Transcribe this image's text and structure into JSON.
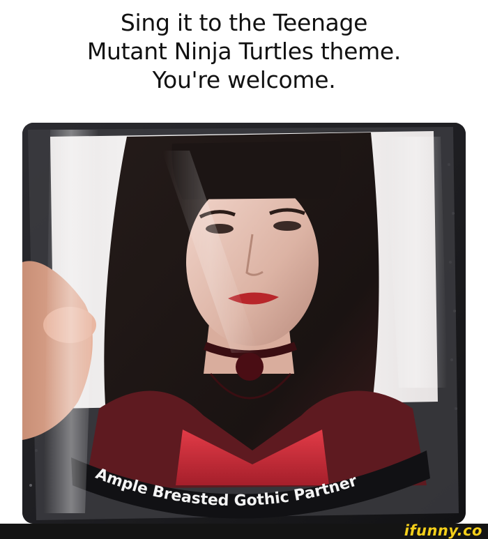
{
  "caption": {
    "line1": "Sing it to the Teenage",
    "line2": "Mutant Ninja Turtles theme.",
    "line3": "You're welcome."
  },
  "photo": {
    "package_label": "Ample Breasted Gothic Partner"
  },
  "watermark": {
    "text": "ifunny.co"
  },
  "colors": {
    "background": "#ffffff",
    "caption_text": "#111111",
    "footer_bar": "#141414",
    "watermark": "#f4cf1a",
    "lips": "#b8262a",
    "hair": "#1e1716",
    "dress": "#d93440"
  }
}
